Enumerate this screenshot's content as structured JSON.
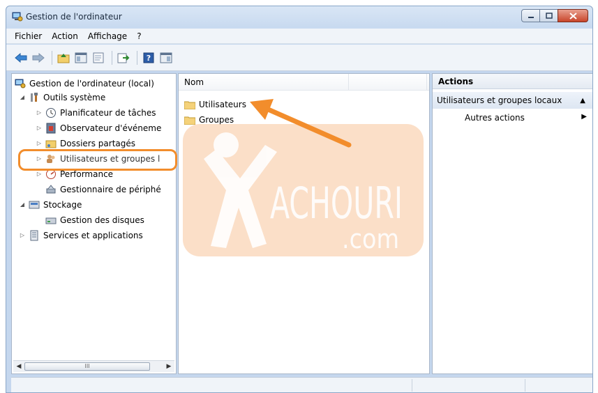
{
  "window": {
    "title": "Gestion de l'ordinateur"
  },
  "menu": [
    "Fichier",
    "Action",
    "Affichage",
    "?"
  ],
  "tree": {
    "root": "Gestion de l'ordinateur (local)",
    "outils": "Outils système",
    "planif": "Planificateur de tâches",
    "observ": "Observateur d'événeme",
    "dossiers": "Dossiers partagés",
    "utilisateurs": "Utilisateurs et groupes l",
    "performance": "Performance",
    "gestionnaire": "Gestionnaire de périphé",
    "stockage": "Stockage",
    "disques": "Gestion des disques",
    "services": "Services et applications",
    "scroll_thumb": "III"
  },
  "list": {
    "column": "Nom",
    "items": [
      "Utilisateurs",
      "Groupes"
    ]
  },
  "actions": {
    "title": "Actions",
    "section": "Utilisateurs et groupes locaux",
    "item": "Autres actions"
  },
  "watermark": {
    "line1": "ACHOURI",
    "line2": ".com"
  },
  "colors": {
    "accent_orange": "#f28d2c",
    "window_blue": "#c5d7ee"
  }
}
